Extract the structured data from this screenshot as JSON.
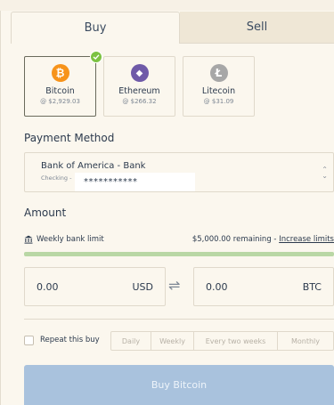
{
  "tabs": {
    "buy": "Buy",
    "sell": "Sell"
  },
  "currencies": [
    {
      "name": "Bitcoin",
      "price": "@ $2,929.03",
      "symbol": "₿",
      "color": "#f7931a",
      "selected": true
    },
    {
      "name": "Ethereum",
      "price": "@ $266.32",
      "symbol": "◆",
      "color": "#6f5aa8",
      "selected": false
    },
    {
      "name": "Litecoin",
      "price": "@ $31.09",
      "symbol": "Ł",
      "color": "#a7a7a7",
      "selected": false
    }
  ],
  "payment": {
    "label": "Payment Method",
    "bank_name": "Bank of America - Bank",
    "account_type": "Checking -",
    "masked_account": "***********"
  },
  "amount": {
    "label": "Amount",
    "limit_label": "Weekly bank limit",
    "limit_remaining": "$5,000.00 remaining - ",
    "limit_link": "Increase limits",
    "limit_remaining_fraction": 1.0,
    "usd_value": "0.00",
    "usd_currency": "USD",
    "btc_value": "0.00",
    "btc_currency": "BTC"
  },
  "repeat": {
    "label": "Repeat this buy",
    "options": [
      "Daily",
      "Weekly",
      "Every two weeks",
      "Monthly"
    ]
  },
  "buy_button": "Buy Bitcoin",
  "colors": {
    "accent_green": "#7cc242",
    "button_blue": "#a9c2dd",
    "background": "#fbf7ee"
  }
}
